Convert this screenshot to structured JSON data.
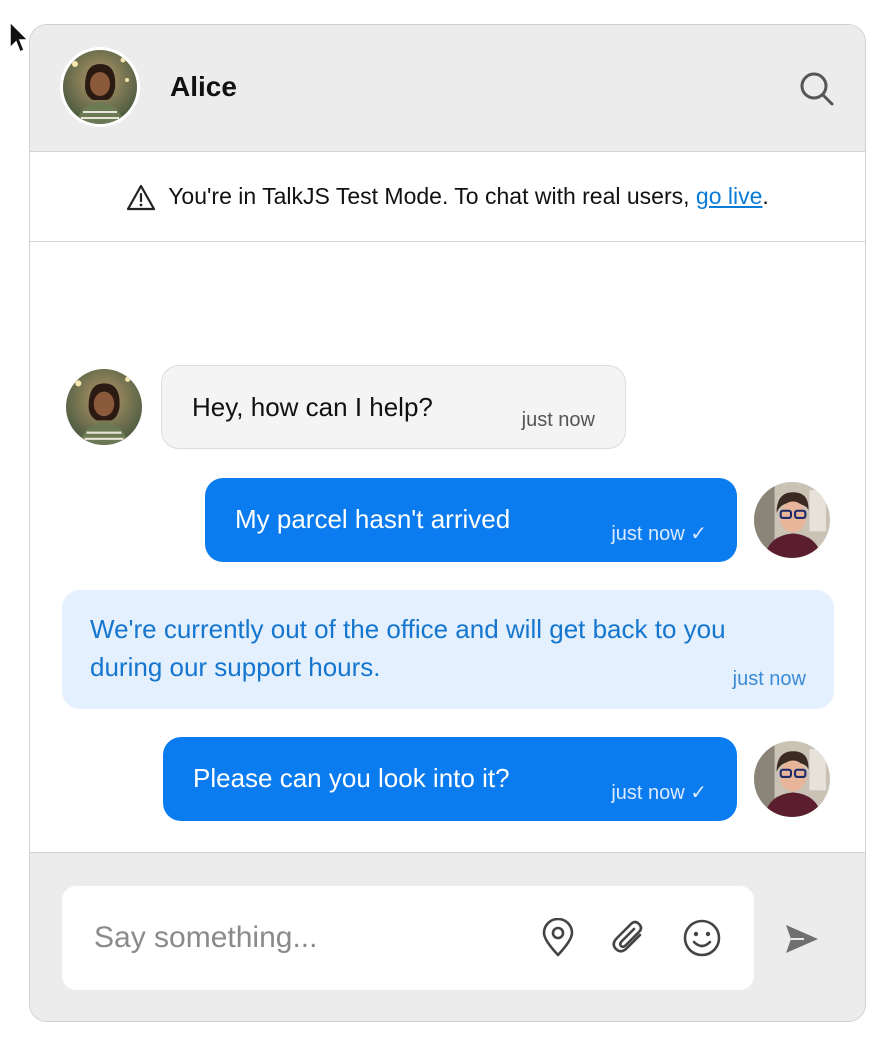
{
  "header": {
    "name": "Alice"
  },
  "notice": {
    "text": "You're in TalkJS Test Mode. To chat with real users, ",
    "link_label": "go live",
    "suffix": "."
  },
  "messages": [
    {
      "sender": "Alice",
      "type": "incoming",
      "text": "Hey, how can I help?",
      "time": "just now"
    },
    {
      "sender": "me",
      "type": "outgoing",
      "text": "My parcel hasn't arrived",
      "time": "just now ✓"
    },
    {
      "sender": "system",
      "type": "system",
      "text": "We're currently out of the office and will get back to you during our support hours.",
      "time": "just now"
    },
    {
      "sender": "me",
      "type": "outgoing",
      "text": "Please can you look into it?",
      "time": "just now ✓"
    }
  ],
  "composer": {
    "placeholder": "Say something...",
    "value": ""
  },
  "icons": {
    "search": "search-icon",
    "warning": "warning-icon",
    "location": "location-pin-icon",
    "attach": "paperclip-icon",
    "emoji": "smiley-icon",
    "send": "send-icon",
    "cursor": "mouse-cursor-icon"
  },
  "colors": {
    "outgoing_bubble": "#0a7cf0",
    "incoming_bubble": "#f4f4f4",
    "system_bubble": "#e4f0fd",
    "system_text": "#1576cf",
    "header_bg": "#ececec",
    "link": "#0a7cd8"
  }
}
